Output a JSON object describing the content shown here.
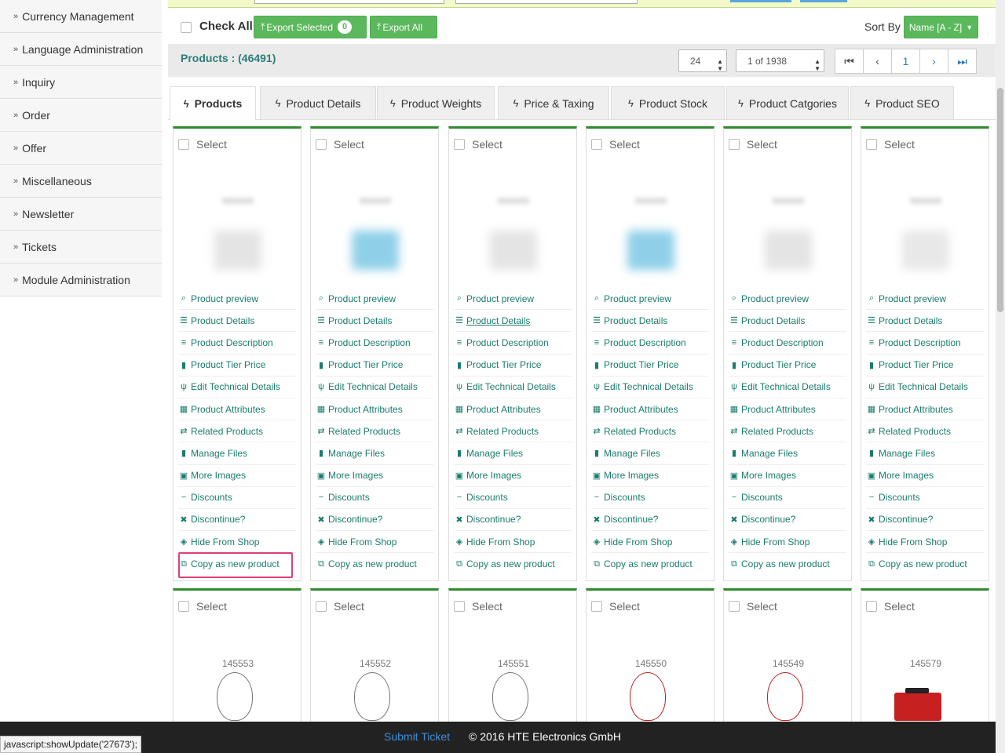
{
  "sidebar": {
    "items": [
      {
        "label": "Currency Management"
      },
      {
        "label": "Language Administration"
      },
      {
        "label": "Inquiry"
      },
      {
        "label": "Order"
      },
      {
        "label": "Offer"
      },
      {
        "label": "Miscellaneous"
      },
      {
        "label": "Newsletter"
      },
      {
        "label": "Tickets"
      },
      {
        "label": "Module Administration"
      }
    ],
    "arrow": "»"
  },
  "toolbar": {
    "check_all": "Check All",
    "export_selected": "Export Selected",
    "export_selected_count": "0",
    "export_all": "Export All",
    "sort_by": "Sort By",
    "sort_value": "Name [A - Z]"
  },
  "products_bar": {
    "title": "Products : (46491)",
    "per_page": "24",
    "page_select": "1 of 1938",
    "current_page": "1"
  },
  "tabs": [
    {
      "label": "Products",
      "active": true
    },
    {
      "label": "Product Details"
    },
    {
      "label": "Product Weights"
    },
    {
      "label": "Price & Taxing"
    },
    {
      "label": "Product Stock"
    },
    {
      "label": "Product Catgories"
    },
    {
      "label": "Product SEO"
    }
  ],
  "card": {
    "select_label": "Select",
    "links": [
      {
        "label": "Product preview",
        "icon": "search-icon"
      },
      {
        "label": "Product Details",
        "icon": "list-icon"
      },
      {
        "label": "Product Description",
        "icon": "align-icon"
      },
      {
        "label": "Product Tier Price",
        "icon": "bar-chart-icon"
      },
      {
        "label": "Edit Technical Details",
        "icon": "cutlery-icon"
      },
      {
        "label": "Product Attributes",
        "icon": "grid-icon"
      },
      {
        "label": "Related Products",
        "icon": "retweet-icon"
      },
      {
        "label": "Manage Files",
        "icon": "file-icon"
      },
      {
        "label": "More Images",
        "icon": "picture-icon"
      },
      {
        "label": "Discounts",
        "icon": "minus-icon"
      },
      {
        "label": "Discontinue?",
        "icon": "remove-icon"
      },
      {
        "label": "Hide From Shop",
        "icon": "eye-slash-icon"
      },
      {
        "label": "Copy as new product",
        "icon": "copy-icon"
      }
    ]
  },
  "second_row_ids": [
    "145553",
    "145552",
    "145551",
    "145550",
    "145549",
    "145579"
  ],
  "footer": {
    "submit_ticket": "Submit Ticket",
    "copyright": "© 2016 HTE Electronics GmbH"
  },
  "status_url": "javascript:showUpdate('27673');",
  "colors": {
    "accent_green": "#5cb85c",
    "link_teal": "#1a7c6e",
    "card_border": "#2e8b2e",
    "highlight": "#e0407a"
  }
}
